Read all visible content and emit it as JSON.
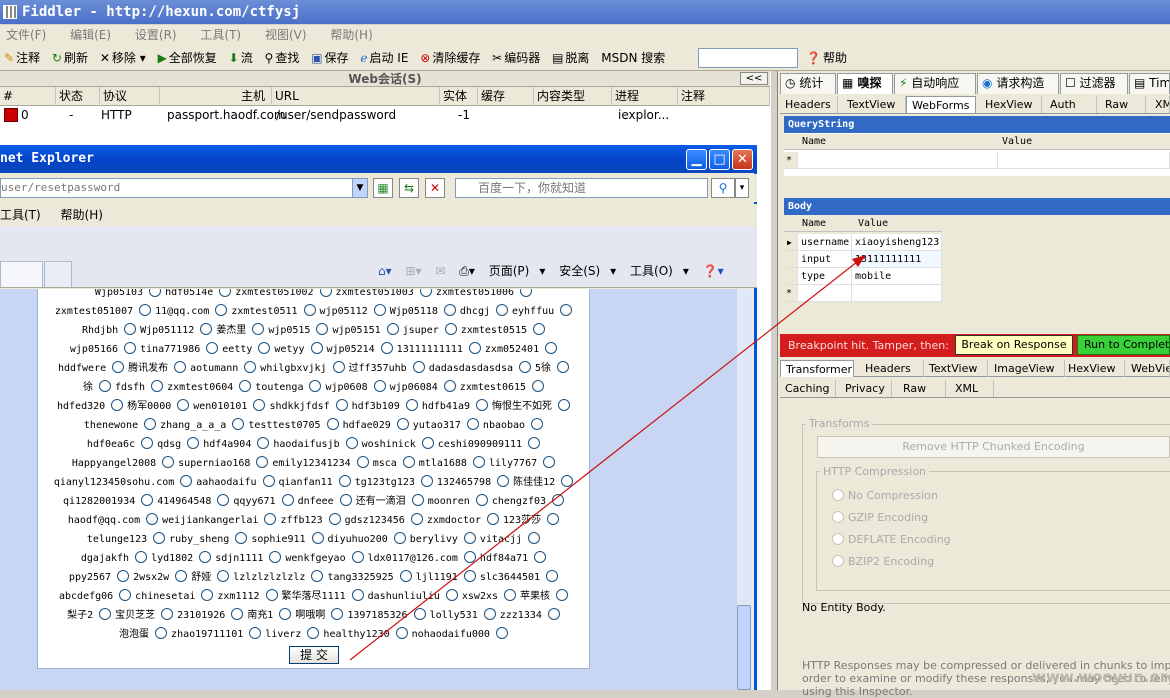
{
  "titlebar": {
    "title": "Fiddler - http://hexun.com/ctfysj"
  },
  "menubar": [
    "文件(F)",
    "编辑(E)",
    "设置(R)",
    "工具(T)",
    "视图(V)",
    "帮助(H)"
  ],
  "toolbar": {
    "items": [
      "注释",
      "刷新",
      "移除",
      "全部恢复",
      "流",
      "查找",
      "保存",
      "启动 IE",
      "清除缓存",
      "编码器",
      "脱离"
    ],
    "msdn_label": "MSDN 搜索",
    "help_label": "帮助"
  },
  "sessions": {
    "header_title": "Web会话(S)",
    "collapse_label": "<<",
    "columns": [
      "#",
      "状态",
      "协议",
      "主机",
      "URL",
      "实体",
      "缓存",
      "内容类型",
      "进程",
      "注释"
    ],
    "row": {
      "num": "0",
      "status": "-",
      "protocol": "HTTP",
      "host": "passport.haodf.com",
      "url": "/user/sendpassword",
      "body": "-1",
      "cache": "",
      "content_type": "",
      "process": "iexplor...",
      "comment": ""
    }
  },
  "ie": {
    "title": "net Explorer",
    "address": "user/resetpassword",
    "search_placeholder": "百度一下，你就知道",
    "menu": [
      "工具(T)",
      "帮助(H)"
    ],
    "commands": [
      "页面(P)",
      "安全(S)",
      "工具(O)"
    ],
    "submit_label": "提 交",
    "options": [
      [
        "Wjp05103",
        "hdf0514e",
        "zxmtest051002",
        "zxmtest051003",
        "zxmtest051006"
      ],
      [
        "zxmtest051007",
        "11@qq.com",
        "zxmtest0511",
        "wjp05112",
        "Wjp05118",
        "dhcgj",
        "eyhffuu"
      ],
      [
        "Rhdjbh",
        "Wjp051112",
        "姜杰里",
        "wjp0515",
        "wjp05151",
        "jsuper",
        "zxmtest0515"
      ],
      [
        "wjp05166",
        "tina771986",
        "eetty",
        "wetyy",
        "wjp05214",
        "13111111111",
        "zxm052401"
      ],
      [
        "hddfwere",
        "腾讯发布",
        "aotumann",
        "whilgbxvjkj",
        "过ff357uhb",
        "dadasdasdasdsa",
        "5徐"
      ],
      [
        "徐",
        "fdsfh",
        "zxmtest0604",
        "toutenga",
        "wjp0608",
        "wjp06084",
        "zxmtest0615"
      ],
      [
        "hdfed320",
        "杨军0000",
        "wen010101",
        "shdkkjfdsf",
        "hdf3b109",
        "hdfb41a9",
        "悔恨生不如死"
      ],
      [
        "thenewone",
        "zhang_a_a_a",
        "testtest0705",
        "hdfae029",
        "yutao317",
        "nbaobao"
      ],
      [
        "hdf0ea6c",
        "qdsg",
        "hdf4a904",
        "haodaifusjb",
        "woshinick",
        "ceshi090909111"
      ],
      [
        "Happyangel2008",
        "superniao168",
        "emily12341234",
        "msca",
        "mtla1688",
        "lily7767"
      ],
      [
        "qianyl123450sohu.com",
        "aahaodaifu",
        "qianfan11",
        "tg123tg123",
        "132465798",
        "陈佳佳12"
      ],
      [
        "qi1282001934",
        "414964548",
        "qqyy671",
        "dnfeee",
        "还有一滴泪",
        "moonren",
        "chengzf03"
      ],
      [
        "haodf@qq.com",
        "weijiankangerlai",
        "zffb123",
        "gdsz123456",
        "zxmdoctor",
        "123莎莎"
      ],
      [
        "telunge123",
        "ruby_sheng",
        "sophie911",
        "diyuhuo200",
        "berylivy",
        "vitacjj"
      ],
      [
        "dgajakfh",
        "lyd1802",
        "sdjn1111",
        "wenkfgeyao",
        "ldx0117@126.com",
        "hdf84a71"
      ],
      [
        "ppy2567",
        "2wsx2w",
        "舒娅",
        "lzlzlzlzlzlz",
        "tang3325925",
        "ljl1191",
        "slc3644501"
      ],
      [
        "abcdefg06",
        "chinesetai",
        "zxm1112",
        "繁华落尽1111",
        "dashunliuliu",
        "xsw2xs",
        "苹果核"
      ],
      [
        "梨子2",
        "宝贝芝芝",
        "23101926",
        "南充1",
        "啊哦啊",
        "1397185326",
        "lolly531",
        "zzz1334"
      ],
      [
        "泡泡蛋",
        "zhao19711101",
        "liverz",
        "healthy1230",
        "nohaodaifu000"
      ]
    ]
  },
  "right": {
    "tabs1": [
      "统计",
      "嗅探",
      "自动响应",
      "请求构造",
      "过滤器",
      "Tim"
    ],
    "tabs2": [
      "Headers",
      "TextView",
      "WebForms",
      "HexView",
      "Auth",
      "Raw",
      "XML"
    ],
    "querystring_title": "QueryString",
    "qs_cols": [
      "Name",
      "Value"
    ],
    "new_row_marker": "*",
    "body_title": "Body",
    "body_cols": [
      "Name",
      "Value"
    ],
    "body_rows": [
      {
        "name": "username",
        "value": "xiaoyisheng123"
      },
      {
        "name": "input",
        "value": "13111111111"
      },
      {
        "name": "type",
        "value": "mobile"
      }
    ],
    "breakpoint_text": "Breakpoint hit.  Tamper, then:",
    "break_btn": "Break on Response",
    "run_btn": "Run to Completion",
    "resp_tabs1": [
      "Transformer",
      "Headers",
      "TextView",
      "ImageView",
      "HexView",
      "WebView"
    ],
    "resp_tabs2": [
      "Caching",
      "Privacy",
      "Raw",
      "XML"
    ],
    "transforms_label": "Transforms",
    "remove_label": "Remove HTTP Chunked Encoding",
    "http_comp_label": "HTTP Compression",
    "comp_options": [
      "No Compression",
      "GZIP Encoding",
      "DEFLATE Encoding",
      "BZIP2 Encoding"
    ],
    "no_entity": "No Entity Body.",
    "footer1": "HTTP Responses may be compressed or delivered in chunks to improve p",
    "footer2": "order to examine or modify these responses, you may need to remove",
    "footer3": "using this Inspector."
  },
  "watermark": "www.wooyun.org",
  "colors": {
    "xp_blue": "#0054e3",
    "section_blue": "#316ac5",
    "breakpoint_red": "#d31d1d",
    "run_green": "#3ad03a",
    "arrow_red": "#cc1010"
  }
}
